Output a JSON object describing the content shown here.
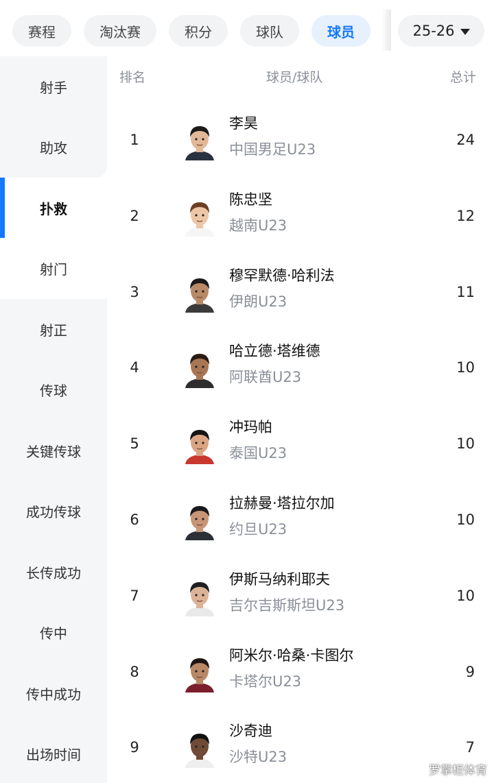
{
  "tabs": [
    {
      "label": "赛程",
      "active": false
    },
    {
      "label": "淘汰赛",
      "active": false
    },
    {
      "label": "积分",
      "active": false
    },
    {
      "label": "球队",
      "active": false
    },
    {
      "label": "球员",
      "active": true
    }
  ],
  "season": {
    "label": "25-26"
  },
  "sidebar": {
    "items": [
      "射手",
      "助攻",
      "扑救",
      "射门",
      "射正",
      "传球",
      "关键传球",
      "成功传球",
      "长传成功",
      "传中",
      "传中成功",
      "出场时间"
    ],
    "active_index": 2
  },
  "table": {
    "headers": {
      "rank": "排名",
      "player": "球员/球队",
      "total": "总计"
    },
    "rows": [
      {
        "rank": "1",
        "name": "李昊",
        "team": "中国男足U23",
        "total": "24",
        "skin": "#e2b898",
        "hair": "#1b1b1b",
        "shirt": "#2a3140"
      },
      {
        "rank": "2",
        "name": "陈忠坚",
        "team": "越南U23",
        "total": "12",
        "skin": "#edc6a7",
        "hair": "#6a3f24",
        "shirt": "#f5f5f5"
      },
      {
        "rank": "3",
        "name": "穆罕默德·哈利法",
        "team": "伊朗U23",
        "total": "11",
        "skin": "#b98a68",
        "hair": "#1a1a1a",
        "shirt": "#3b3b3b"
      },
      {
        "rank": "4",
        "name": "哈立德·塔维德",
        "team": "阿联酋U23",
        "total": "10",
        "skin": "#a97654",
        "hair": "#2a1c14",
        "shirt": "#2e2e2e"
      },
      {
        "rank": "5",
        "name": "冲玛帕",
        "team": "泰国U23",
        "total": "10",
        "skin": "#d9a583",
        "hair": "#151515",
        "shirt": "#c9382f"
      },
      {
        "rank": "6",
        "name": "拉赫曼·塔拉尔加",
        "team": "约旦U23",
        "total": "10",
        "skin": "#c89576",
        "hair": "#1a1a1a",
        "shirt": "#2c2f36"
      },
      {
        "rank": "7",
        "name": "伊斯马纳利耶夫",
        "team": "吉尔吉斯斯坦U23",
        "total": "10",
        "skin": "#dcb397",
        "hair": "#1f1f1f",
        "shirt": "#e9e9e9"
      },
      {
        "rank": "8",
        "name": "阿米尔·哈桑·卡图尔",
        "team": "卡塔尔U23",
        "total": "9",
        "skin": "#b98866",
        "hair": "#1e1612",
        "shirt": "#7b1f2e"
      },
      {
        "rank": "9",
        "name": "沙奇迪",
        "team": "沙特U23",
        "total": "7",
        "skin": "#6f4a36",
        "hair": "#111111",
        "shirt": "#eeeeee"
      }
    ]
  },
  "watermark": "罗掌柜体育"
}
